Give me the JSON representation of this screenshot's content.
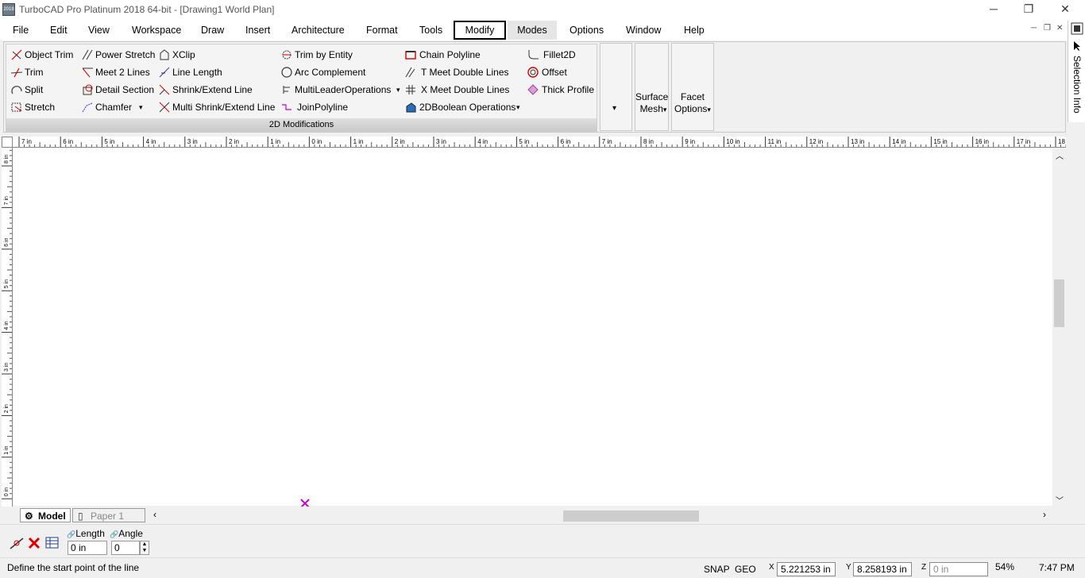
{
  "window": {
    "title": "TurboCAD Pro Platinum 2018 64-bit - [Drawing1 World Plan]",
    "app_icon_text": "2018",
    "minimize": "─",
    "restore": "❐",
    "close": "✕"
  },
  "menu": [
    "File",
    "Edit",
    "View",
    "Workspace",
    "Draw",
    "Insert",
    "Architecture",
    "Format",
    "Tools",
    "Modify",
    "Modes",
    "Options",
    "Window",
    "Help"
  ],
  "ribbon": {
    "group_label": "2D Modifications",
    "col1": [
      "Object Trim",
      "Trim",
      "Split",
      "Stretch"
    ],
    "col2": [
      "Power Stretch",
      "Meet 2 Lines",
      "Detail Section",
      "Chamfer"
    ],
    "col3": [
      "XClip",
      "Line Length",
      "Shrink/Extend Line",
      "Multi Shrink/Extend Line"
    ],
    "col4": [
      "Trim by Entity",
      "Arc Complement",
      "MultiLeaderOperations",
      "JoinPolyline"
    ],
    "col5": [
      "Chain Polyline",
      "T Meet Double Lines",
      "X Meet Double Lines",
      "2DBoolean Operations"
    ],
    "col6": [
      "Fillet2D",
      "Offset",
      "Thick Profile"
    ],
    "dropdown_arrow": "▾",
    "big_buttons": [
      {
        "line1": "Surface",
        "line2": "Mesh"
      },
      {
        "line1": "Facet",
        "line2": "Options"
      }
    ]
  },
  "selection_info": "Selection Info",
  "hruler_labels": [
    "7 in",
    "6 in",
    "5 in",
    "4 in",
    "3 in",
    "2 in",
    "1 in",
    "0 in",
    "1 in",
    "2 in",
    "3 in",
    "4 in",
    "5 in",
    "6 in",
    "7 in",
    "8 in",
    "9 in",
    "10 in",
    "11 in",
    "12 in",
    "13 in",
    "14 in",
    "15 in",
    "16 in",
    "17 in",
    "18 in"
  ],
  "vruler_labels": [
    "8 in",
    "7 in",
    "6 in",
    "5 in",
    "4 in",
    "3 in",
    "2 in",
    "1 in",
    "0 in"
  ],
  "tabs": {
    "model": "Model",
    "paper": "Paper 1"
  },
  "inspector": {
    "length_label": "Length",
    "angle_label": "Angle",
    "length_value": "0 in",
    "angle_value": "0"
  },
  "status": {
    "prompt": "Define the start point of the line",
    "snap": "SNAP",
    "geo": "GEO",
    "x_label": "X",
    "y_label": "Y",
    "z_label": "Z",
    "x_value": "5.221253 in",
    "y_value": "8.258193 in",
    "z_value": "0 in",
    "zoom": "54%",
    "time": "7:47 PM"
  },
  "colors": {
    "accent": "#cc00cc",
    "marker": "#cc00cc"
  }
}
